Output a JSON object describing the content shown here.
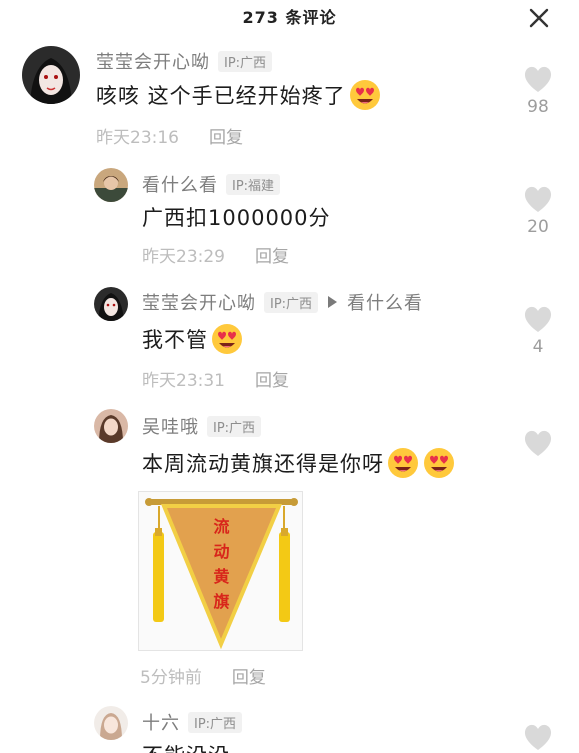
{
  "header": {
    "title": "273 条评论"
  },
  "comments": [
    {
      "name": "莹莹会开心呦",
      "ip": "IP:广西",
      "text": "咳咳 这个手已经开始疼了",
      "time": "昨天23:16",
      "reply": "回复",
      "likes": "98"
    },
    {
      "name": "看什么看",
      "ip": "IP:福建",
      "text": "广西扣1000000分",
      "time": "昨天23:29",
      "reply": "回复",
      "likes": "20"
    },
    {
      "name": "莹莹会开心呦",
      "ip": "IP:广西",
      "reply_to": "看什么看",
      "text": "我不管",
      "time": "昨天23:31",
      "reply": "回复",
      "likes": "4"
    },
    {
      "name": "吴哇哦",
      "ip": "IP:广西",
      "text": "本周流动黄旗还得是你呀",
      "image_text": [
        "流",
        "动",
        "黄",
        "旗"
      ],
      "time": "5分钟前",
      "reply": "回复",
      "likes": ""
    },
    {
      "name": "十六",
      "ip": "IP:广西",
      "text": "不能没没"
    }
  ],
  "colors": {
    "like_heart": "#d9d9d9",
    "pennant": "#e2a14e",
    "pennant_text": "#d8261b"
  }
}
